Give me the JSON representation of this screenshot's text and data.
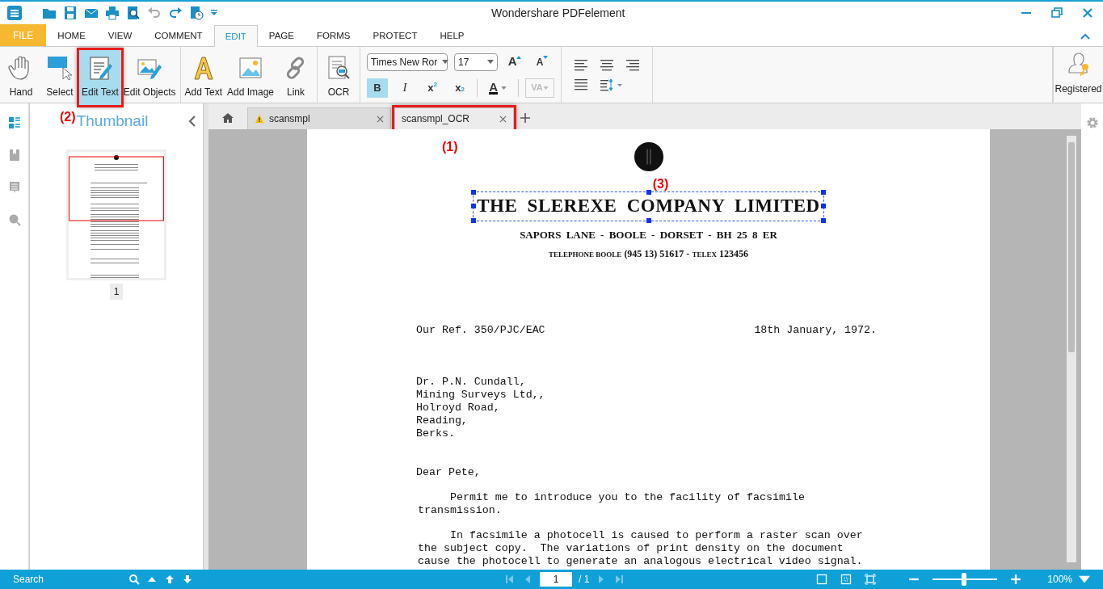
{
  "window": {
    "title": "Wondershare PDFelement"
  },
  "ribbon_tabs": [
    {
      "label": "FILE",
      "kind": "file",
      "selected": false
    },
    {
      "label": "HOME",
      "kind": "tab",
      "selected": false
    },
    {
      "label": "VIEW",
      "kind": "tab",
      "selected": false
    },
    {
      "label": "COMMENT",
      "kind": "tab",
      "selected": false
    },
    {
      "label": "EDIT",
      "kind": "tab",
      "selected": true
    },
    {
      "label": "PAGE",
      "kind": "tab",
      "selected": false
    },
    {
      "label": "FORMS",
      "kind": "tab",
      "selected": false
    },
    {
      "label": "PROTECT",
      "kind": "tab",
      "selected": false
    },
    {
      "label": "HELP",
      "kind": "tab",
      "selected": false
    }
  ],
  "tool_groups": [
    [
      {
        "label": "Hand",
        "kind": "hand",
        "selected": false
      },
      {
        "label": "Select",
        "kind": "select",
        "selected": false
      },
      {
        "label": "Edit Text",
        "kind": "edittext",
        "selected": true,
        "annotation": "(2)"
      },
      {
        "label": "Edit Objects",
        "kind": "editobjects",
        "selected": false
      }
    ],
    [
      {
        "label": "Add Text",
        "kind": "addtext",
        "selected": false
      },
      {
        "label": "Add Image",
        "kind": "addimage",
        "selected": false
      },
      {
        "label": "Link",
        "kind": "link",
        "selected": false
      }
    ],
    [
      {
        "label": "OCR",
        "kind": "ocr",
        "selected": false
      }
    ]
  ],
  "font": {
    "family": "Times New Ror",
    "size": "17"
  },
  "size_buttons": [
    {
      "glyph": "A",
      "kind": "grow"
    },
    {
      "glyph": "A",
      "kind": "shrink"
    }
  ],
  "format_buttons": [
    {
      "glyph": "B",
      "kind": "bold",
      "selected": true
    },
    {
      "glyph": "I",
      "kind": "italic",
      "selected": false
    },
    {
      "glyph": "x$^{2}$",
      "kind": "superscript",
      "selected": false
    },
    {
      "glyph": "x$_{2}$",
      "kind": "subscript",
      "selected": false
    }
  ],
  "font_color": {
    "glyph": "A"
  },
  "char_spacing": {
    "glyph": "VA",
    "disabled": true
  },
  "registered": {
    "label": "Registered"
  },
  "side_rail": [
    {
      "kind": "thumbnails",
      "selected": true
    },
    {
      "kind": "bookmarks",
      "selected": false
    },
    {
      "kind": "comments",
      "selected": false
    },
    {
      "kind": "search",
      "selected": false
    }
  ],
  "thumbnail_panel": {
    "title": "Thumbnail",
    "page_label": "1"
  },
  "doc_tabs": [
    {
      "label": "scansmpl",
      "warning": true,
      "selected": false
    },
    {
      "label": "scansmpl_OCR",
      "warning": false,
      "selected": true,
      "annotation": "(1)"
    }
  ],
  "document": {
    "heading": "THE SLEREXE COMPANY LIMITED",
    "heading_annotation": "(3)",
    "address": "SAPORS LANE - BOOLE - DORSET - BH 25 8 ER",
    "telephone": [
      {
        "text": "TELEPHONE BOOLE",
        "small": true
      },
      {
        "text": " (945 13) 51617 - ",
        "small": false
      },
      {
        "text": "TELEX",
        "small": true
      },
      {
        "text": " 123456",
        "small": false
      }
    ],
    "reference": "Our Ref. 350/PJC/EAC",
    "date": "18th January, 1972.",
    "recipient": [
      "Dr. P.N. Cundall,",
      "Mining Surveys Ltd,,",
      "Holroyd Road,",
      "Reading,",
      "Berks."
    ],
    "salutation": "Dear Pete,",
    "paragraphs": [
      [
        "Permit me to introduce you to the facility of facsimile",
        "transmission."
      ],
      [
        "In facsimile a photocell is caused to perform a raster scan over",
        "the subject copy.  The variations of print density on the document",
        "cause the photocell to generate an analogous electrical video signal."
      ]
    ]
  },
  "status_bar": {
    "search": "Search",
    "page": "1",
    "page_total": "/ 1",
    "zoom": "100%",
    "zoom_slider": {
      "level": 0.48
    }
  }
}
